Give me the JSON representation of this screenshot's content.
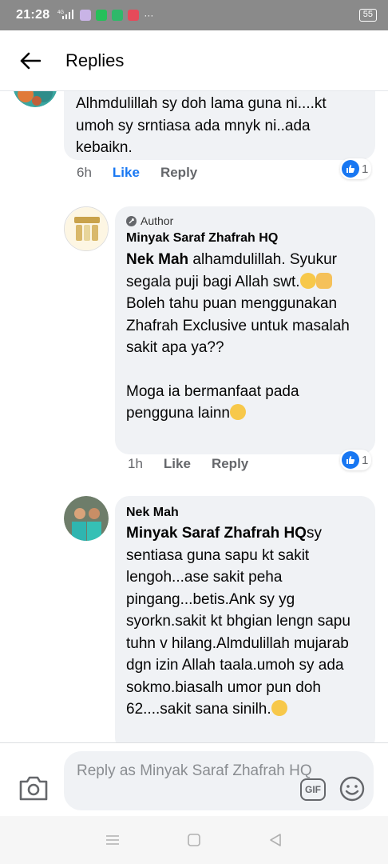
{
  "status_bar": {
    "time": "21:28",
    "network": "4G",
    "battery": "55",
    "icons": [
      "signal-icon",
      "app-icon",
      "whatsapp-icon",
      "whatsapp-business-icon",
      "media-icon",
      "more-dots-icon"
    ]
  },
  "header": {
    "title": "Replies",
    "back_icon": "arrow-left-icon"
  },
  "comments": [
    {
      "text": "Alhmdulillah sy doh lama guna ni....kt umoh sy srntiasa ada mnyk ni..ada kebaikn.",
      "time": "6h",
      "like_label": "Like",
      "reply_label": "Reply",
      "reaction_count": "1"
    },
    {
      "badge": "Author",
      "name": "Minyak Saraf Zhafrah  HQ",
      "mention": "Nek Mah",
      "text_part1": " alhamdulillah. Syukur segala puji bagi Allah swt.",
      "text_part2": " Boleh tahu puan menggunakan Zhafrah Exclusive untuk masalah sakit apa ya??",
      "text_part3": "Moga ia bermanfaat pada pengguna lainn",
      "time": "1h",
      "like_label": "Like",
      "reply_label": "Reply",
      "reaction_count": "1"
    },
    {
      "name": "Nek Mah",
      "mention": "Minyak Saraf Zhafrah  HQ",
      "text": "sy sentiasa guna sapu kt sakit lengoh...ase sakit peha pingang...betis.Ank sy yg syorkn.sakit kt bhgian lengn sapu tuhn v hilang.Almdulillah mujarab dgn izin Allah taala.umoh sy ada sokmo.biasalh umor pun doh 62....sakit sana sinilh."
    }
  ],
  "composer": {
    "placeholder": "Reply as Minyak Saraf Zhafrah  HQ",
    "gif_label": "GIF"
  },
  "navbar": {
    "icons": [
      "menu-icon",
      "home-square-icon",
      "back-triangle-icon"
    ]
  },
  "colors": {
    "accent": "#1877f2",
    "bubble": "#f0f2f5",
    "meta": "#65676b",
    "status_bar": "#8a8a8a"
  }
}
